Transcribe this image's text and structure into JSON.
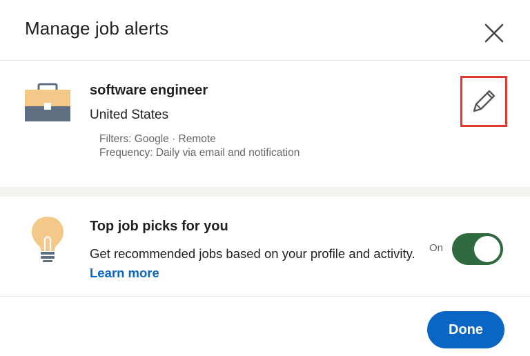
{
  "dialog": {
    "title": "Manage job alerts",
    "close_icon": "close-icon"
  },
  "alert": {
    "icon": "briefcase-icon",
    "title": "software engineer",
    "location": "United States",
    "filters": "Filters: Google · Remote",
    "frequency": "Frequency: Daily via email and notification",
    "edit_icon": "pencil-icon"
  },
  "top_picks": {
    "icon": "lightbulb-icon",
    "title": "Top job picks for you",
    "description": "Get recommended jobs based on your profile and activity.",
    "learn_more": "Learn more",
    "toggle_label": "On",
    "toggle_on": true
  },
  "footer": {
    "done_label": "Done"
  },
  "colors": {
    "accent": "#0a66c2",
    "toggle_on": "#2f6b3f",
    "highlight_box": "#e03a2f"
  }
}
